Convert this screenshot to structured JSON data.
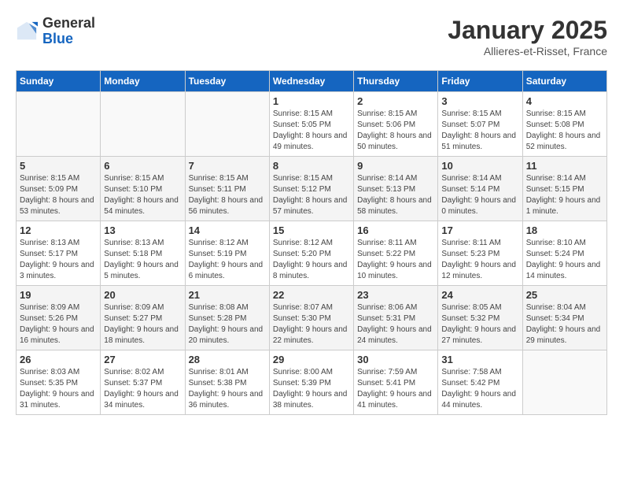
{
  "logo": {
    "general": "General",
    "blue": "Blue"
  },
  "title": "January 2025",
  "subtitle": "Allieres-et-Risset, France",
  "weekdays": [
    "Sunday",
    "Monday",
    "Tuesday",
    "Wednesday",
    "Thursday",
    "Friday",
    "Saturday"
  ],
  "weeks": [
    [
      {
        "day": "",
        "sunrise": "",
        "sunset": "",
        "daylight": ""
      },
      {
        "day": "",
        "sunrise": "",
        "sunset": "",
        "daylight": ""
      },
      {
        "day": "",
        "sunrise": "",
        "sunset": "",
        "daylight": ""
      },
      {
        "day": "1",
        "sunrise": "Sunrise: 8:15 AM",
        "sunset": "Sunset: 5:05 PM",
        "daylight": "Daylight: 8 hours and 49 minutes."
      },
      {
        "day": "2",
        "sunrise": "Sunrise: 8:15 AM",
        "sunset": "Sunset: 5:06 PM",
        "daylight": "Daylight: 8 hours and 50 minutes."
      },
      {
        "day": "3",
        "sunrise": "Sunrise: 8:15 AM",
        "sunset": "Sunset: 5:07 PM",
        "daylight": "Daylight: 8 hours and 51 minutes."
      },
      {
        "day": "4",
        "sunrise": "Sunrise: 8:15 AM",
        "sunset": "Sunset: 5:08 PM",
        "daylight": "Daylight: 8 hours and 52 minutes."
      }
    ],
    [
      {
        "day": "5",
        "sunrise": "Sunrise: 8:15 AM",
        "sunset": "Sunset: 5:09 PM",
        "daylight": "Daylight: 8 hours and 53 minutes."
      },
      {
        "day": "6",
        "sunrise": "Sunrise: 8:15 AM",
        "sunset": "Sunset: 5:10 PM",
        "daylight": "Daylight: 8 hours and 54 minutes."
      },
      {
        "day": "7",
        "sunrise": "Sunrise: 8:15 AM",
        "sunset": "Sunset: 5:11 PM",
        "daylight": "Daylight: 8 hours and 56 minutes."
      },
      {
        "day": "8",
        "sunrise": "Sunrise: 8:15 AM",
        "sunset": "Sunset: 5:12 PM",
        "daylight": "Daylight: 8 hours and 57 minutes."
      },
      {
        "day": "9",
        "sunrise": "Sunrise: 8:14 AM",
        "sunset": "Sunset: 5:13 PM",
        "daylight": "Daylight: 8 hours and 58 minutes."
      },
      {
        "day": "10",
        "sunrise": "Sunrise: 8:14 AM",
        "sunset": "Sunset: 5:14 PM",
        "daylight": "Daylight: 9 hours and 0 minutes."
      },
      {
        "day": "11",
        "sunrise": "Sunrise: 8:14 AM",
        "sunset": "Sunset: 5:15 PM",
        "daylight": "Daylight: 9 hours and 1 minute."
      }
    ],
    [
      {
        "day": "12",
        "sunrise": "Sunrise: 8:13 AM",
        "sunset": "Sunset: 5:17 PM",
        "daylight": "Daylight: 9 hours and 3 minutes."
      },
      {
        "day": "13",
        "sunrise": "Sunrise: 8:13 AM",
        "sunset": "Sunset: 5:18 PM",
        "daylight": "Daylight: 9 hours and 5 minutes."
      },
      {
        "day": "14",
        "sunrise": "Sunrise: 8:12 AM",
        "sunset": "Sunset: 5:19 PM",
        "daylight": "Daylight: 9 hours and 6 minutes."
      },
      {
        "day": "15",
        "sunrise": "Sunrise: 8:12 AM",
        "sunset": "Sunset: 5:20 PM",
        "daylight": "Daylight: 9 hours and 8 minutes."
      },
      {
        "day": "16",
        "sunrise": "Sunrise: 8:11 AM",
        "sunset": "Sunset: 5:22 PM",
        "daylight": "Daylight: 9 hours and 10 minutes."
      },
      {
        "day": "17",
        "sunrise": "Sunrise: 8:11 AM",
        "sunset": "Sunset: 5:23 PM",
        "daylight": "Daylight: 9 hours and 12 minutes."
      },
      {
        "day": "18",
        "sunrise": "Sunrise: 8:10 AM",
        "sunset": "Sunset: 5:24 PM",
        "daylight": "Daylight: 9 hours and 14 minutes."
      }
    ],
    [
      {
        "day": "19",
        "sunrise": "Sunrise: 8:09 AM",
        "sunset": "Sunset: 5:26 PM",
        "daylight": "Daylight: 9 hours and 16 minutes."
      },
      {
        "day": "20",
        "sunrise": "Sunrise: 8:09 AM",
        "sunset": "Sunset: 5:27 PM",
        "daylight": "Daylight: 9 hours and 18 minutes."
      },
      {
        "day": "21",
        "sunrise": "Sunrise: 8:08 AM",
        "sunset": "Sunset: 5:28 PM",
        "daylight": "Daylight: 9 hours and 20 minutes."
      },
      {
        "day": "22",
        "sunrise": "Sunrise: 8:07 AM",
        "sunset": "Sunset: 5:30 PM",
        "daylight": "Daylight: 9 hours and 22 minutes."
      },
      {
        "day": "23",
        "sunrise": "Sunrise: 8:06 AM",
        "sunset": "Sunset: 5:31 PM",
        "daylight": "Daylight: 9 hours and 24 minutes."
      },
      {
        "day": "24",
        "sunrise": "Sunrise: 8:05 AM",
        "sunset": "Sunset: 5:32 PM",
        "daylight": "Daylight: 9 hours and 27 minutes."
      },
      {
        "day": "25",
        "sunrise": "Sunrise: 8:04 AM",
        "sunset": "Sunset: 5:34 PM",
        "daylight": "Daylight: 9 hours and 29 minutes."
      }
    ],
    [
      {
        "day": "26",
        "sunrise": "Sunrise: 8:03 AM",
        "sunset": "Sunset: 5:35 PM",
        "daylight": "Daylight: 9 hours and 31 minutes."
      },
      {
        "day": "27",
        "sunrise": "Sunrise: 8:02 AM",
        "sunset": "Sunset: 5:37 PM",
        "daylight": "Daylight: 9 hours and 34 minutes."
      },
      {
        "day": "28",
        "sunrise": "Sunrise: 8:01 AM",
        "sunset": "Sunset: 5:38 PM",
        "daylight": "Daylight: 9 hours and 36 minutes."
      },
      {
        "day": "29",
        "sunrise": "Sunrise: 8:00 AM",
        "sunset": "Sunset: 5:39 PM",
        "daylight": "Daylight: 9 hours and 38 minutes."
      },
      {
        "day": "30",
        "sunrise": "Sunrise: 7:59 AM",
        "sunset": "Sunset: 5:41 PM",
        "daylight": "Daylight: 9 hours and 41 minutes."
      },
      {
        "day": "31",
        "sunrise": "Sunrise: 7:58 AM",
        "sunset": "Sunset: 5:42 PM",
        "daylight": "Daylight: 9 hours and 44 minutes."
      },
      {
        "day": "",
        "sunrise": "",
        "sunset": "",
        "daylight": ""
      }
    ]
  ]
}
